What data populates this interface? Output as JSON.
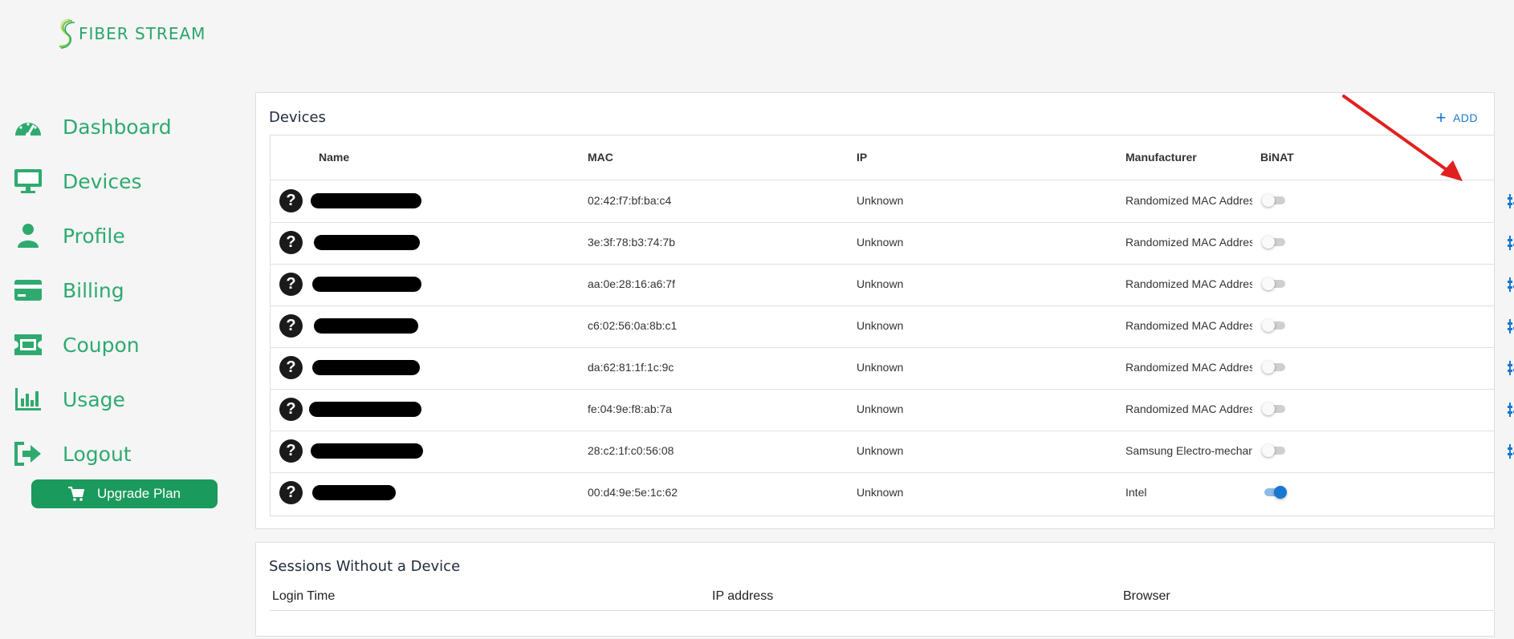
{
  "brand": {
    "name": "FIBER STREAM",
    "color": "#2aa56a"
  },
  "nav": [
    {
      "label": "Dashboard",
      "icon": "gauge-icon"
    },
    {
      "label": "Devices",
      "icon": "monitor-icon"
    },
    {
      "label": "Profile",
      "icon": "person-icon"
    },
    {
      "label": "Billing",
      "icon": "credit-card-icon"
    },
    {
      "label": "Coupon",
      "icon": "ticket-icon"
    },
    {
      "label": "Usage",
      "icon": "bar-chart-icon"
    },
    {
      "label": "Logout",
      "icon": "logout-icon"
    }
  ],
  "upgrade": {
    "label": "Upgrade Plan",
    "icon": "cart-icon"
  },
  "devices": {
    "title": "Devices",
    "add_label": "ADD",
    "columns": {
      "name": "Name",
      "mac": "MAC",
      "ip": "IP",
      "manufacturer": "Manufacturer",
      "binat": "BiNAT"
    },
    "rows": [
      {
        "mac": "02:42:f7:bf:ba:c4",
        "ip": "Unknown",
        "manufacturer": "Randomized MAC Address",
        "binat": false,
        "settings": true
      },
      {
        "mac": "3e:3f:78:b3:74:7b",
        "ip": "Unknown",
        "manufacturer": "Randomized MAC Address",
        "binat": false,
        "settings": true
      },
      {
        "mac": "aa:0e:28:16:a6:7f",
        "ip": "Unknown",
        "manufacturer": "Randomized MAC Address",
        "binat": false,
        "settings": true
      },
      {
        "mac": "c6:02:56:0a:8b:c1",
        "ip": "Unknown",
        "manufacturer": "Randomized MAC Address",
        "binat": false,
        "settings": true
      },
      {
        "mac": "da:62:81:1f:1c:9c",
        "ip": "Unknown",
        "manufacturer": "Randomized MAC Address",
        "binat": false,
        "settings": true
      },
      {
        "mac": "fe:04:9e:f8:ab:7a",
        "ip": "Unknown",
        "manufacturer": "Randomized MAC Address",
        "binat": false,
        "settings": true
      },
      {
        "mac": "28:c2:1f:c0:56:08",
        "ip": "Unknown",
        "manufacturer": "Samsung Electro-mechanics",
        "binat": false,
        "settings": true
      },
      {
        "mac": "00:d4:9e:5e:1c:62",
        "ip": "Unknown",
        "manufacturer": "Intel",
        "binat": true,
        "settings": false
      }
    ]
  },
  "sessions": {
    "title": "Sessions Without a Device",
    "columns": {
      "login_time": "Login Time",
      "ip": "IP address",
      "browser": "Browser"
    }
  },
  "colors": {
    "accent_green": "#2eaa6f",
    "button_green": "#1a9a5c",
    "action_blue": "#1976d2",
    "delete_red": "#d32f2f",
    "annotation_red": "#e02020"
  }
}
